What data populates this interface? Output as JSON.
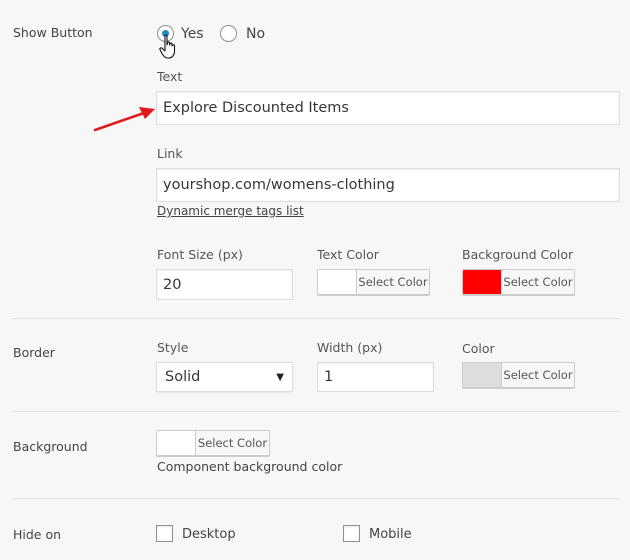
{
  "show_button": {
    "label": "Show Button",
    "options": [
      "Yes",
      "No"
    ],
    "selected": "Yes"
  },
  "text_field": {
    "label": "Text",
    "value": "Explore Discounted Items"
  },
  "link_field": {
    "label": "Link",
    "value": "yourshop.com/womens-clothing",
    "merge_tags_link": "Dynamic merge tags list"
  },
  "font_size": {
    "label": "Font Size (px)",
    "value": "20"
  },
  "text_color": {
    "label": "Text Color",
    "button": "Select Color",
    "swatch": "#ffffff"
  },
  "background_color": {
    "label": "Background Color",
    "button": "Select Color",
    "swatch": "#ff0000"
  },
  "border": {
    "label": "Border",
    "style_label": "Style",
    "style_value": "Solid",
    "width_label": "Width (px)",
    "width_value": "1",
    "color_label": "Color",
    "color_button": "Select Color",
    "color_swatch": "#dddddd"
  },
  "background": {
    "label": "Background",
    "button": "Select Color",
    "swatch": "#ffffff",
    "helper": "Component background color"
  },
  "hide_on": {
    "label": "Hide on",
    "options": [
      "Desktop",
      "Mobile"
    ]
  },
  "colors": {
    "accent": "#1e8cbe",
    "annotation_arrow": "#e0191b"
  }
}
